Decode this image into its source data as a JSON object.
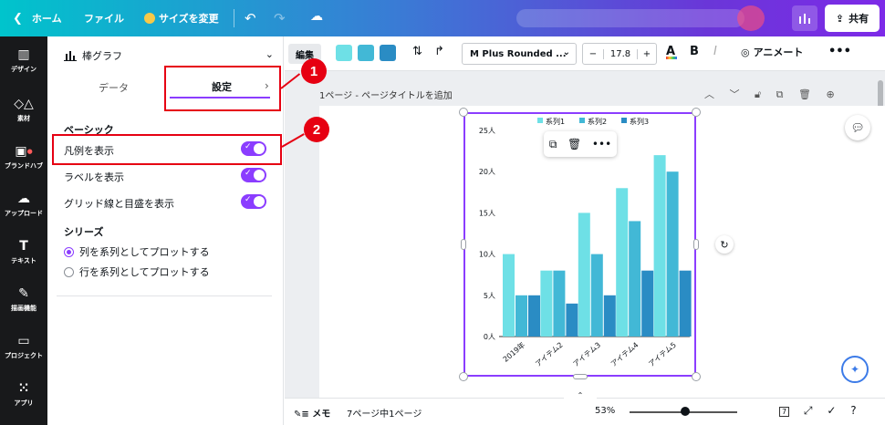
{
  "topbar": {
    "home": "ホーム",
    "file": "ファイル",
    "resize": "サイズを変更",
    "share": "共有"
  },
  "rail": [
    {
      "label": "デザイン",
      "icon": "layout-icon"
    },
    {
      "label": "素材",
      "icon": "elements-icon"
    },
    {
      "label": "ブランドハブ",
      "icon": "brand-icon"
    },
    {
      "label": "アップロード",
      "icon": "upload-icon"
    },
    {
      "label": "テキスト",
      "icon": "text-icon"
    },
    {
      "label": "描画機能",
      "icon": "draw-icon"
    },
    {
      "label": "プロジェクト",
      "icon": "folder-icon"
    },
    {
      "label": "アプリ",
      "icon": "apps-icon"
    }
  ],
  "panel": {
    "chart_type": "棒グラフ",
    "tabs": [
      "データ",
      "設定"
    ],
    "section_basic": "ベーシック",
    "toggles": [
      {
        "label": "凡例を表示",
        "on": true
      },
      {
        "label": "ラベルを表示",
        "on": true
      },
      {
        "label": "グリッド線と目盛を表示",
        "on": true
      }
    ],
    "section_series": "シリーズ",
    "radios": [
      {
        "label": "列を系列としてプロットする",
        "selected": true
      },
      {
        "label": "行を系列としてプロットする",
        "selected": false
      }
    ]
  },
  "toolbar": {
    "edit": "編集",
    "swatches": [
      "#6ee0e6",
      "#42b8d6",
      "#2a8cc4"
    ],
    "font": "M Plus Rounded ...",
    "size_minus": "−",
    "font_size": "17.8",
    "size_plus": "+",
    "bold": "B",
    "italic": "I",
    "animate": "アニメート",
    "more": "•••"
  },
  "page": {
    "label": "1ページ - ページタイトルを追加"
  },
  "bottombar": {
    "memo": "メモ",
    "pages": "7ページ中1ページ",
    "zoom": "53%",
    "zoom_level": 0.53,
    "page_count_badge": "7"
  },
  "annotations": {
    "badge1": "1",
    "badge2": "2"
  },
  "chart_data": {
    "type": "bar",
    "categories": [
      "2019年",
      "アイテム2",
      "アイテム3",
      "アイテム4",
      "アイテム5"
    ],
    "series": [
      {
        "name": "系列1",
        "values": [
          10,
          8,
          15,
          18,
          22
        ],
        "color": "#6ee0e6"
      },
      {
        "name": "系列2",
        "values": [
          5,
          8,
          10,
          14,
          20
        ],
        "color": "#42b8d6"
      },
      {
        "name": "系列3",
        "values": [
          5,
          4,
          5,
          8,
          8
        ],
        "color": "#2a8cc4"
      }
    ],
    "yticks": [
      "0人",
      "5人",
      "10人",
      "15人",
      "20人",
      "25人"
    ],
    "ylim": [
      0,
      25
    ],
    "legend": "top",
    "grid": false
  }
}
